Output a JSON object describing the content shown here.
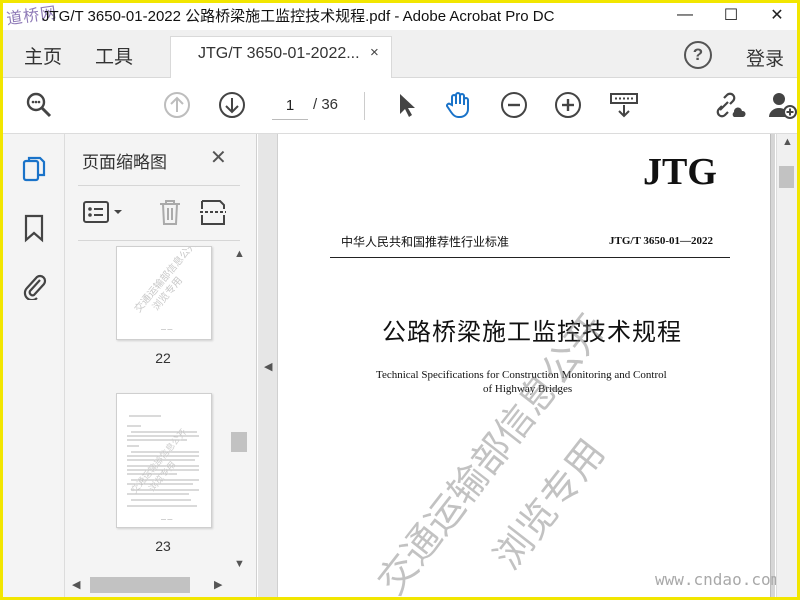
{
  "window": {
    "logo_text": "道桥网",
    "title": "JTG/T 3650-01-2022 公路桥梁施工监控技术规程.pdf - Adobe Acrobat Pro DC",
    "min_glyph": "—",
    "max_glyph": "☐",
    "close_glyph": "✕"
  },
  "menu": {
    "home": "主页",
    "tools": "工具",
    "doc_tab": "JTG/T 3650-01-2022...",
    "doc_tab_close": "×",
    "help": "?",
    "login": "登录"
  },
  "toolbar": {
    "icons": [
      "zoom-search-icon",
      "page-up-icon",
      "page-down-icon",
      "select-cursor-icon",
      "hand-tool-icon",
      "zoom-out-icon",
      "zoom-in-icon",
      "page-fit-icon",
      "share-link-icon",
      "add-user-icon"
    ],
    "page_current": "1",
    "page_total": "/ 36"
  },
  "rail": {
    "icons": [
      "page-thumbnails-icon",
      "bookmark-icon",
      "attachment-icon"
    ]
  },
  "thumbnails_pane": {
    "title": "页面缩略图",
    "close": "✕",
    "icons": [
      "options-menu-icon",
      "delete-icon",
      "extract-icon"
    ],
    "pages": [
      {
        "number": "22"
      },
      {
        "number": "23"
      }
    ]
  },
  "document": {
    "code_big": "JTG",
    "standard_type": "中华人民共和国推荐性行业标准",
    "standard_code": "JTG/T 3650-01—2022",
    "title_cn": "公路桥梁施工监控技术规程",
    "title_en_line1": "Technical Specifications for Construction Monitoring and Control",
    "title_en_line2": "of Highway Bridges",
    "watermark_line1": "交通运输部信息公开",
    "watermark_line2": "浏览专用",
    "site_mark": "www.cndao.com"
  }
}
